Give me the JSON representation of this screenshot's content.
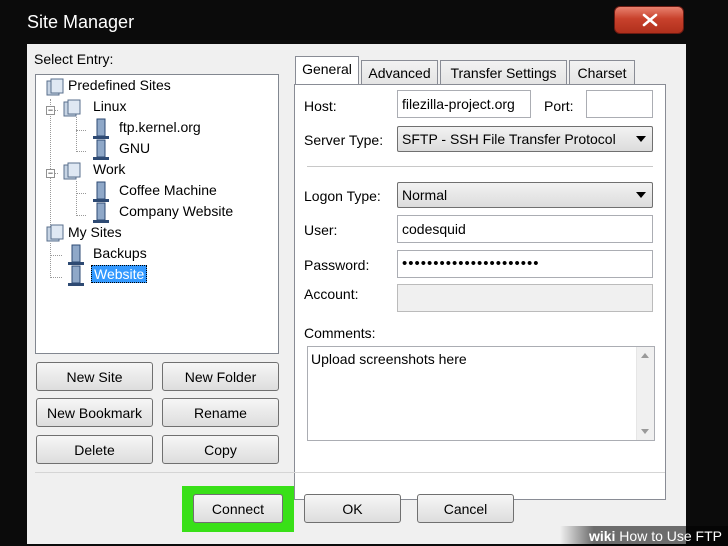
{
  "window": {
    "title": "Site Manager"
  },
  "tree": {
    "label": "Select Entry:",
    "nodes": [
      {
        "label": "Predefined Sites"
      },
      {
        "label": "Linux"
      },
      {
        "label": "ftp.kernel.org"
      },
      {
        "label": "GNU"
      },
      {
        "label": "Work"
      },
      {
        "label": "Coffee Machine"
      },
      {
        "label": "Company Website"
      },
      {
        "label": "My Sites"
      },
      {
        "label": "Backups"
      },
      {
        "label": "Website"
      }
    ]
  },
  "left_buttons": {
    "new_site": "New Site",
    "new_folder": "New Folder",
    "new_bookmark": "New Bookmark",
    "rename": "Rename",
    "delete": "Delete",
    "copy": "Copy"
  },
  "tabs": [
    "General",
    "Advanced",
    "Transfer Settings",
    "Charset"
  ],
  "general": {
    "host_label": "Host:",
    "host_value": "filezilla-project.org",
    "port_label": "Port:",
    "port_value": "",
    "server_type_label": "Server Type:",
    "server_type_value": "SFTP - SSH File Transfer Protocol",
    "logon_type_label": "Logon Type:",
    "logon_type_value": "Normal",
    "user_label": "User:",
    "user_value": "codesquid",
    "password_label": "Password:",
    "password_value": "••••••••••••••••••••••",
    "account_label": "Account:",
    "account_value": "",
    "comments_label": "Comments:",
    "comments_value": "Upload screenshots here"
  },
  "footer": {
    "connect": "Connect",
    "ok": "OK",
    "cancel": "Cancel"
  },
  "watermark": {
    "brand": "wiki",
    "text": "How to Use FTP"
  },
  "colors": {
    "highlight": "#39e018",
    "selection": "#3399ff",
    "close_button": "#c8412c"
  }
}
